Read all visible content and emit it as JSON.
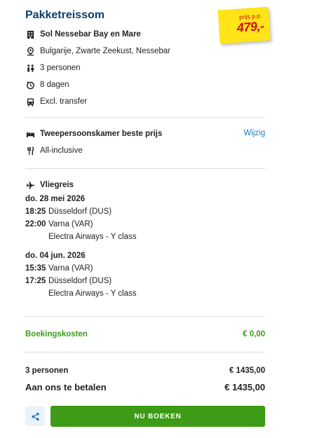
{
  "header": {
    "title": "Pakketreissom"
  },
  "price_badge": {
    "label": "prijs p.p.",
    "price": "479,-",
    "bg_color": "#ffe417",
    "text_color": "#d00d1a"
  },
  "hotel": {
    "name": "Sol Nessebar Bay en Mare",
    "location": "Bulgarije, Zwarte Zeekust, Nessebar",
    "persons": "3 personen",
    "duration": "8 dagen",
    "transfer": "Excl. transfer"
  },
  "room": {
    "type": "Tweepersoonskamer beste prijs",
    "change_link": "Wijzig",
    "board": "All-inclusive"
  },
  "flight": {
    "heading": "Vliegreis",
    "outbound": {
      "date": "do. 28 mei 2026",
      "dep_time": "18:25",
      "dep_place": "Düsseldorf (DUS)",
      "arr_time": "22:00",
      "arr_place": "Varna (VAR)",
      "carrier": "Electra Airways - Y class"
    },
    "return": {
      "date": "do. 04 jun. 2026",
      "dep_time": "15:35",
      "dep_place": "Varna (VAR)",
      "arr_time": "17:25",
      "arr_place": "Düsseldorf (DUS)",
      "carrier": "Electra Airways - Y class"
    }
  },
  "costs": {
    "booking_label": "Boekingskosten",
    "booking_value": "€ 0,00",
    "persons_label": "3 personen",
    "persons_value": "€ 1435,00",
    "total_label": "Aan ons te betalen",
    "total_value": "€ 1435,00"
  },
  "actions": {
    "book_label": "NU BOEKEN"
  },
  "colors": {
    "title": "#0b3f6b",
    "accent_green": "#3c9a1a",
    "button_green": "#3d9b16",
    "link_blue": "#1a7fc4"
  }
}
